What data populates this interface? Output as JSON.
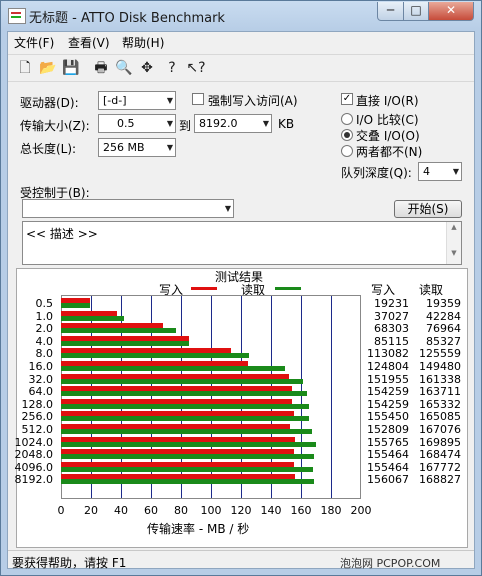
{
  "window": {
    "title": "无标题 - ATTO Disk Benchmark",
    "min": "─",
    "max": "□",
    "close": "✕"
  },
  "menu": [
    "文件(F)",
    "查看(V)",
    "帮助(H)"
  ],
  "toolbar_icons": [
    "new-file-icon",
    "open-folder-icon",
    "save-icon",
    "print-icon",
    "print-preview-icon",
    "move-icon",
    "help-icon",
    "context-help-icon"
  ],
  "toolbar_glyphs": [
    "🗋",
    "📂",
    "💾",
    "🖶",
    "🔍",
    "✥",
    "?",
    "↖?"
  ],
  "settings": {
    "drive_label": "驱动器(D):",
    "drive_value": "[-d-]",
    "force_write_label": "强制写入访问(A)",
    "direct_io_label": "直接 I/O(R)",
    "direct_io_checked": true,
    "transfer_label": "传输大小(Z):",
    "transfer_from": "0.5",
    "to_label": "到",
    "transfer_to": "8192.0",
    "kb_label": "KB",
    "total_label": "总长度(L):",
    "total_value": "256 MB",
    "io_compare": "I/O 比较(C)",
    "io_overlap": "交叠 I/O(O)",
    "neither": "两者都不(N)",
    "queue_label": "队列深度(Q):",
    "queue_value": "4",
    "controlled_label": "受控制于(B):",
    "start_button": "开始(S)",
    "description": "<< 描述 >>"
  },
  "results": {
    "title": "测试结果",
    "legend_write": "写入",
    "legend_read": "读取",
    "col_write": "写入",
    "col_read": "读取",
    "xlabel": "传输速率 - MB / 秒"
  },
  "colors": {
    "write": "#e01010",
    "read": "#1a8a1a",
    "grid": "#1c2a8a"
  },
  "chart_data": {
    "type": "bar",
    "orientation": "horizontal",
    "title": "测试结果",
    "xlabel": "传输速率 - MB / 秒",
    "xlim": [
      0,
      200
    ],
    "xticks": [
      0,
      20,
      40,
      60,
      80,
      100,
      120,
      140,
      160,
      180,
      200
    ],
    "categories": [
      "0.5",
      "1.0",
      "2.0",
      "4.0",
      "8.0",
      "16.0",
      "32.0",
      "64.0",
      "128.0",
      "256.0",
      "512.0",
      "1024.0",
      "2048.0",
      "4096.0",
      "8192.0"
    ],
    "series": [
      {
        "name": "写入",
        "values": [
          19231,
          37027,
          68303,
          85115,
          113082,
          124804,
          151955,
          154259,
          154259,
          155450,
          152809,
          155765,
          155464,
          155464,
          156067
        ]
      },
      {
        "name": "读取",
        "values": [
          19359,
          42284,
          76964,
          85327,
          125559,
          149480,
          161338,
          163711,
          165332,
          165085,
          167076,
          169895,
          168474,
          167772,
          168827
        ]
      }
    ]
  },
  "status": {
    "help": "要获得帮助，请按 F1",
    "watermark": "泡泡网 PCPOP.COM"
  }
}
